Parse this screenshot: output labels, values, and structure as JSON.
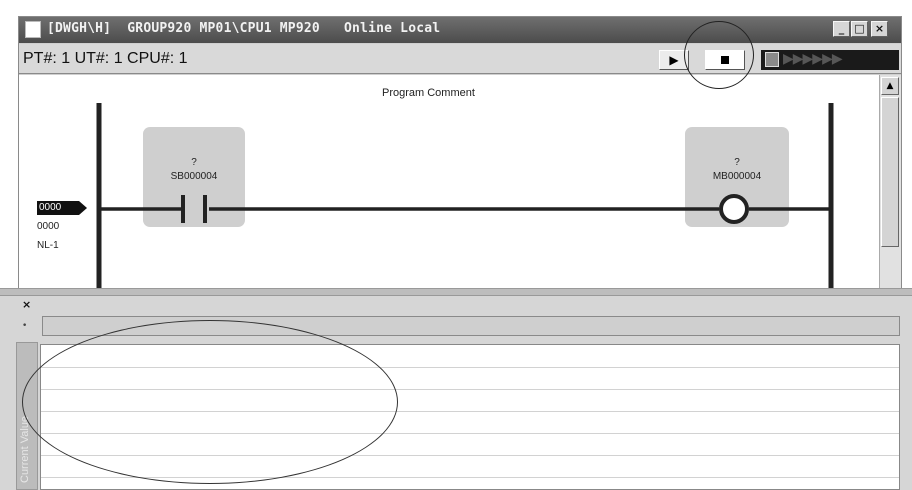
{
  "window": {
    "title": "[DWGH\\H]  GROUP920 MP01\\CPU1 MP920   Online Local",
    "minimize_label": "_",
    "maximize_label": "□",
    "close_label": "×"
  },
  "status_bar": {
    "text": "PT#: 1 UT#: 1 CPU#: 1",
    "run_label": "▶",
    "step_arrows": "▶▶▶▶▶▶"
  },
  "ladder": {
    "program_comment": "Program Comment",
    "step_number": "0000",
    "step_number_2": "0000",
    "nl_label": "NL-1",
    "contact": {
      "comment": "?",
      "address": "SB000004"
    },
    "coil": {
      "comment": "?",
      "address": "MB000004"
    }
  },
  "bottom_pane": {
    "close_label": "×",
    "dot_label": "•",
    "side_tab_label": "Current Value"
  }
}
